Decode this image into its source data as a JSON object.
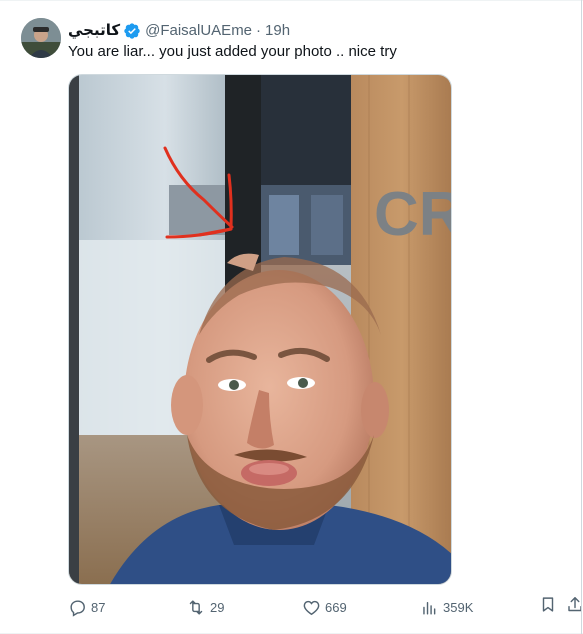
{
  "tweet": {
    "display_name": "كاتبجي",
    "handle": "@FaisalUAEme",
    "separator": "·",
    "timestamp": "19h",
    "text": "You are liar... you just added your photo .. nice try",
    "media": {
      "wall_lettering": "CRO",
      "description_icon": "photo"
    }
  },
  "actions": {
    "replies": "87",
    "retweets": "29",
    "likes": "669",
    "views": "359K"
  },
  "colors": {
    "text_primary": "#0f1419",
    "text_secondary": "#536471",
    "verified": "#1d9bf0",
    "annotation_arrow": "#e0301e"
  }
}
